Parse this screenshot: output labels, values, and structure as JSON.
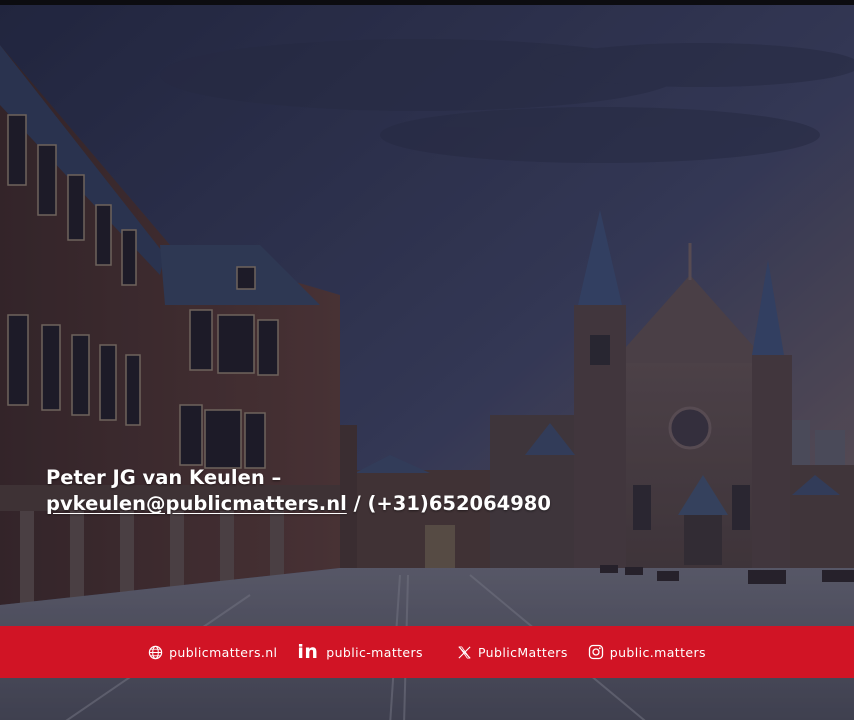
{
  "contact": {
    "name_line": "Peter JG van Keulen –",
    "email": "pvkeulen@publicmatters.nl",
    "separator": "/",
    "phone": "(+31)652064980"
  },
  "footer": {
    "items": [
      {
        "icon": "globe-icon",
        "label": "publicmatters.nl"
      },
      {
        "icon": "linkedin-icon",
        "label": "public-matters"
      },
      {
        "icon": "x-logo-icon",
        "label": "PublicMatters"
      },
      {
        "icon": "instagram-icon",
        "label": "public.matters"
      }
    ]
  },
  "colors": {
    "footer_bar": "#d11425",
    "overlay": "#2b2f4a",
    "text": "#ffffff"
  }
}
